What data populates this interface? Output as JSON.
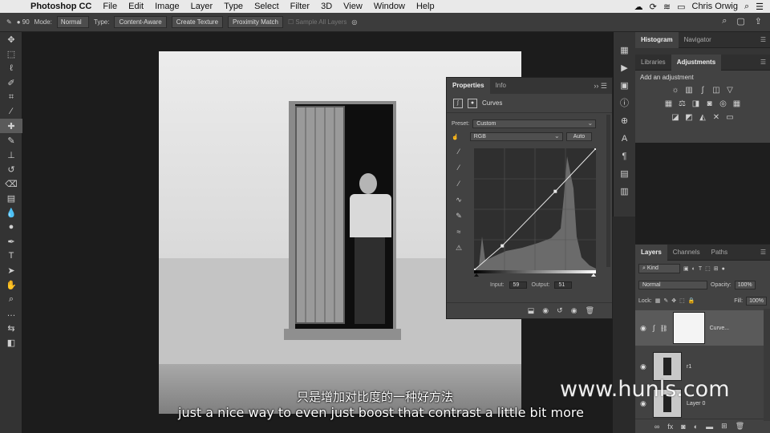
{
  "menubar": {
    "app_name": "Photoshop CC",
    "items": [
      "File",
      "Edit",
      "Image",
      "Layer",
      "Type",
      "Select",
      "Filter",
      "3D",
      "View",
      "Window",
      "Help"
    ],
    "user": "Chris Orwig"
  },
  "options": {
    "brush_size": "90",
    "mode_label": "Mode:",
    "mode_value": "Normal",
    "type_label": "Type:",
    "type_content_aware": "Content-Aware",
    "type_create_texture": "Create Texture",
    "type_proximity_match": "Proximity Match",
    "sample_all_layers": "Sample All Layers"
  },
  "properties": {
    "tab_properties": "Properties",
    "tab_info": "Info",
    "adjustment_name": "Curves",
    "preset_label": "Preset:",
    "preset_value": "Custom",
    "channel_value": "RGB",
    "auto_button": "Auto",
    "input_label": "Input:",
    "input_value": "59",
    "output_label": "Output:",
    "output_value": "51"
  },
  "panels": {
    "tab_histogram": "Histogram",
    "tab_navigator": "Navigator",
    "tab_libraries": "Libraries",
    "tab_adjustments": "Adjustments",
    "add_adjustment": "Add an adjustment",
    "tab_layers": "Layers",
    "tab_channels": "Channels",
    "tab_paths": "Paths"
  },
  "layers": {
    "filter_kind": "Kind",
    "blend_mode": "Normal",
    "opacity_label": "Opacity:",
    "opacity_value": "100%",
    "lock_label": "Lock:",
    "fill_label": "Fill:",
    "fill_value": "100%",
    "items": [
      {
        "name": "Curve..."
      },
      {
        "name": "r1"
      },
      {
        "name": "Layer 0"
      }
    ]
  },
  "subtitles": {
    "chinese": "只是增加对比度的一种好方法",
    "english": "just a nice way to even just boost that contrast a little bit more"
  },
  "watermark": "www.hunls.com",
  "curve": {
    "points": [
      [
        0,
        0
      ],
      [
        59,
        51
      ],
      [
        170,
        165
      ],
      [
        255,
        255
      ]
    ]
  }
}
